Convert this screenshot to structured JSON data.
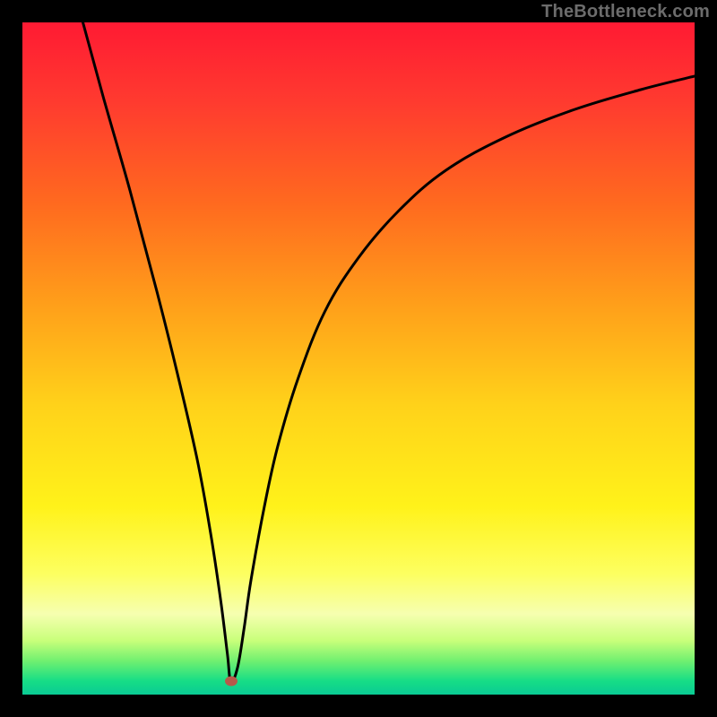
{
  "watermark": "TheBottleneck.com",
  "colors": {
    "curve": "#000000",
    "dot": "#b55a4a",
    "gradient_top": "#ff1a33",
    "gradient_bottom": "#0acb94",
    "frame": "#000000"
  },
  "chart_data": {
    "type": "line",
    "title": "",
    "xlabel": "",
    "ylabel": "",
    "xlim": [
      0,
      100
    ],
    "ylim": [
      0,
      100
    ],
    "annotations": [
      {
        "name": "min-point-marker",
        "x": 31,
        "y": 2
      }
    ],
    "series": [
      {
        "name": "bottleneck-curve",
        "x": [
          9,
          12,
          16,
          20,
          23,
          26,
          28,
          29.5,
          30.5,
          31,
          32,
          33,
          34,
          36,
          38,
          41,
          45,
          50,
          56,
          63,
          72,
          82,
          92,
          100
        ],
        "y": [
          100,
          89,
          75,
          60,
          48,
          35,
          24,
          14,
          6,
          2,
          4,
          10,
          17,
          28,
          37,
          47,
          57,
          65,
          72,
          78,
          83,
          87,
          90,
          92
        ]
      }
    ]
  }
}
